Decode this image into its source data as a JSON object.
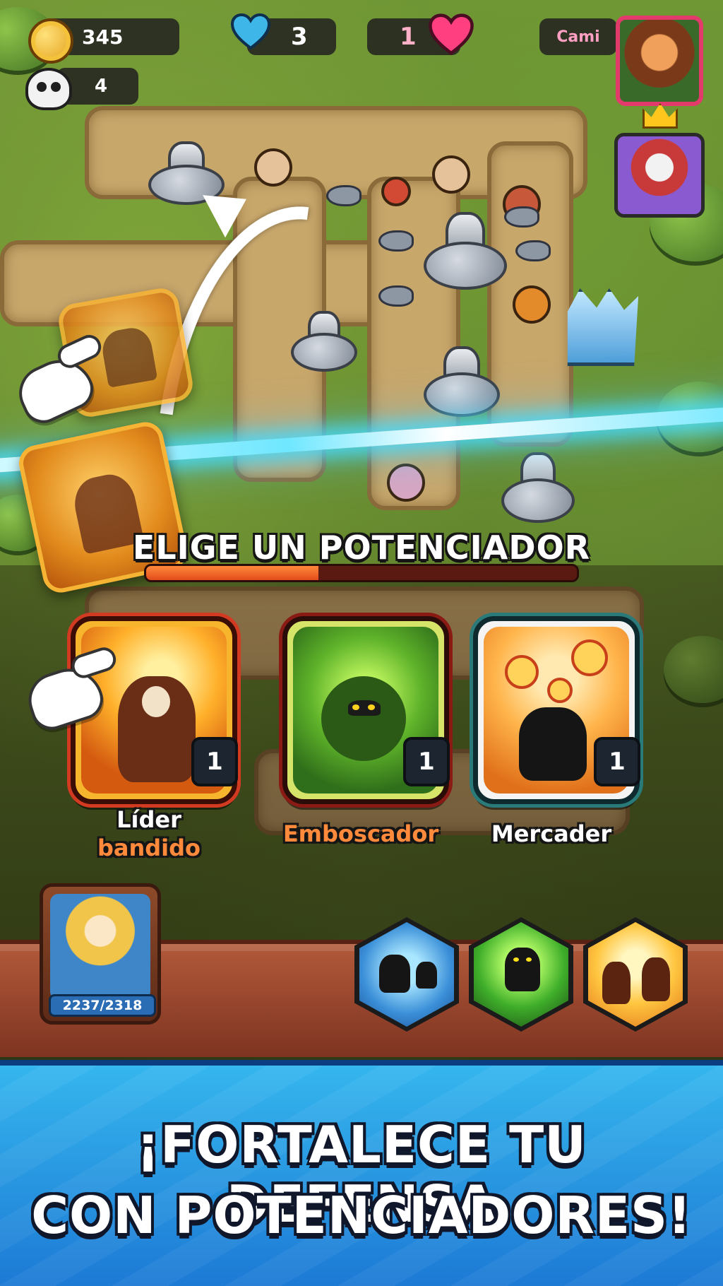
{
  "hud": {
    "coins": "345",
    "lives": "3",
    "versus_score": "1",
    "kills": "4",
    "opponent_name": "Cami",
    "coin_icon": "coin-icon",
    "lives_icon": "blue-heart-icon",
    "versus_icon": "pink-heart-icon",
    "kills_icon": "skull-icon"
  },
  "chooser": {
    "title": "ELIGE UN POTENCIADOR",
    "timer_remaining_fraction": 0.4
  },
  "cards": [
    {
      "label_line1": "Líder",
      "label_line2": "bandido",
      "level": "1",
      "art_icon": "bandit-leader-icon"
    },
    {
      "label_line1": "Emboscador",
      "level": "1",
      "art_icon": "ambusher-icon"
    },
    {
      "label_line1": "Mercader",
      "level": "1",
      "art_icon": "merchant-icon"
    }
  ],
  "hero": {
    "hp": "2237/2318",
    "portrait_icon": "hero-portrait"
  },
  "skills": [
    {
      "icon": "ice-minions-skill-icon"
    },
    {
      "icon": "shadow-skill-icon"
    },
    {
      "icon": "rally-skill-icon"
    }
  ],
  "banner": {
    "line1": "¡FORTALECE TU DEFENSA",
    "line2": "CON POTENCIADORES!"
  },
  "colors": {
    "banner_blue": "#2a9be6",
    "lightning": "#6fe7ff",
    "timer_fill": "#e24a1a",
    "label_orange": "#ff8a3c"
  }
}
